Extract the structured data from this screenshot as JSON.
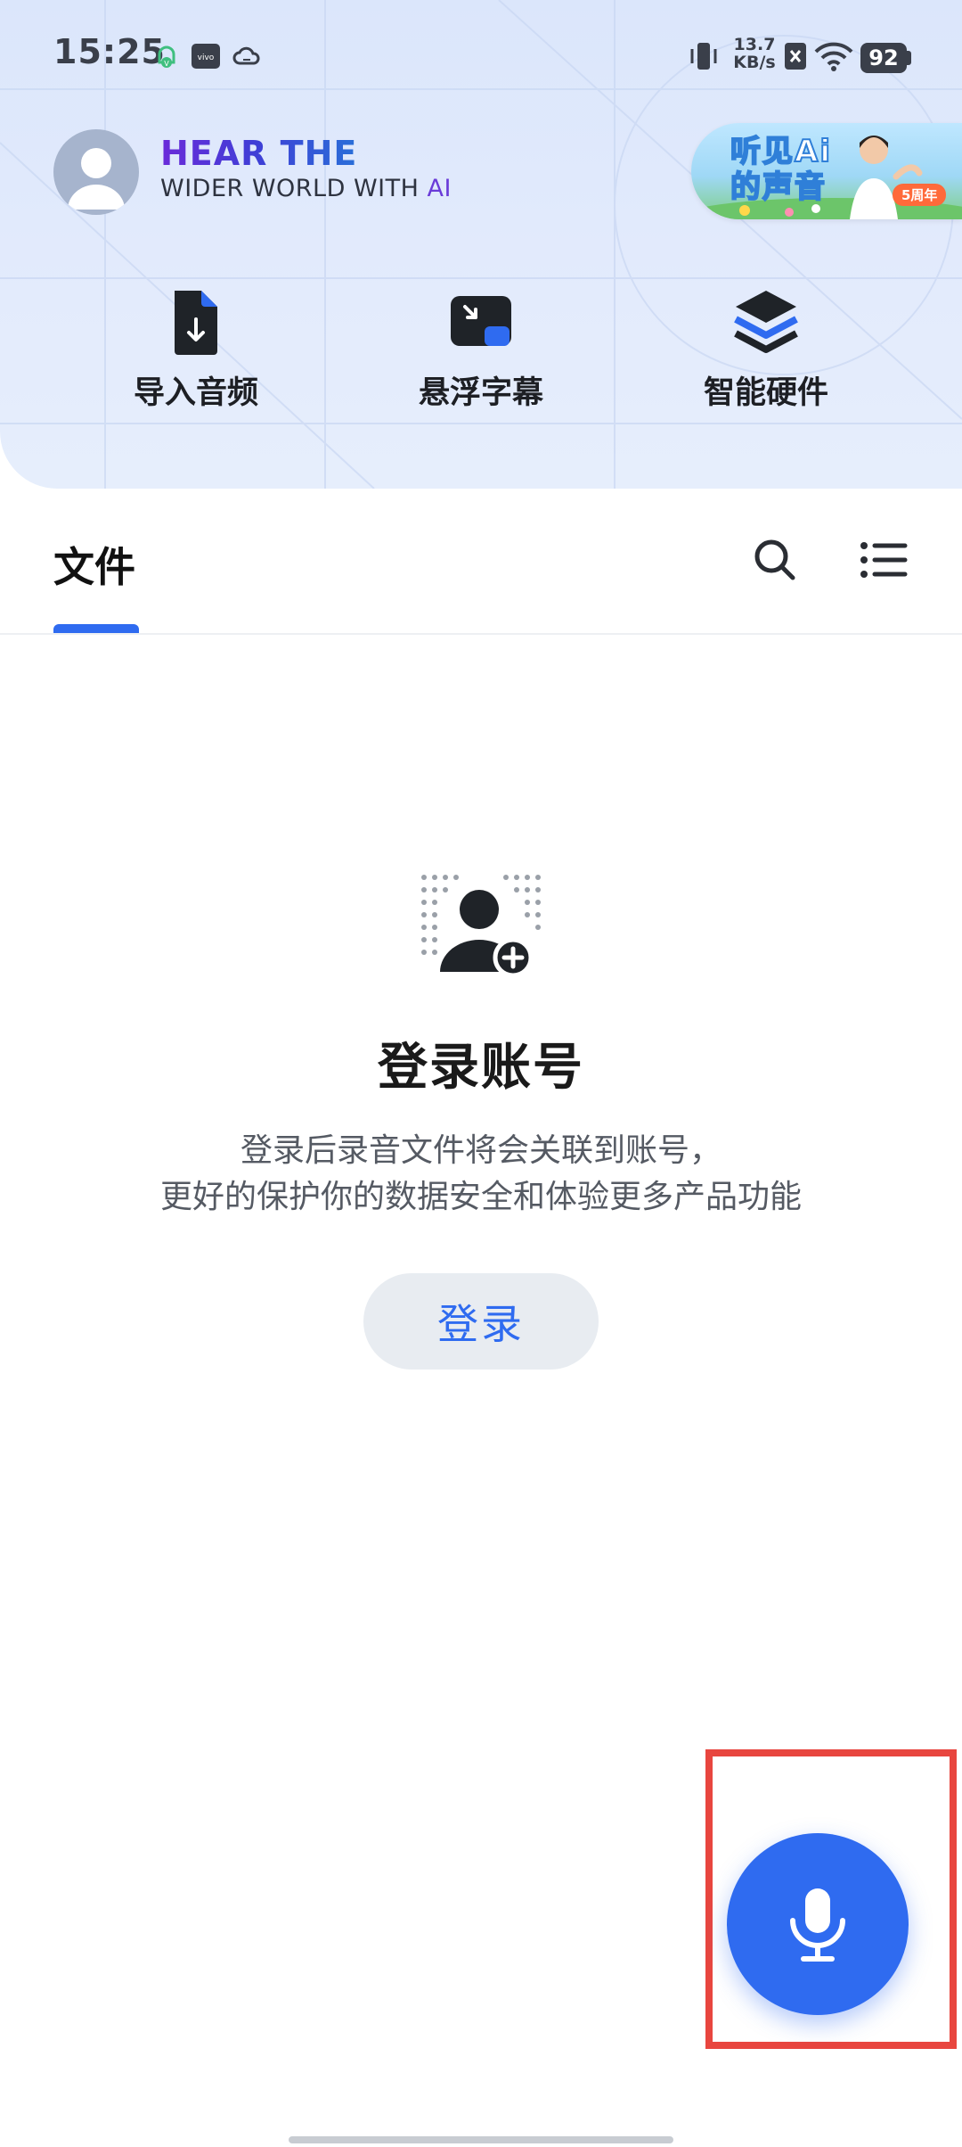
{
  "status_bar": {
    "time": "15:25",
    "net_speed_value": "13.7",
    "net_speed_unit": "KB/s",
    "battery": "92",
    "icons": [
      "notification-bell-icon",
      "vivo-icon",
      "cloud-icon",
      "vibrate-icon",
      "no-sim-icon",
      "wifi-icon",
      "battery-icon"
    ]
  },
  "profile": {
    "slogan_line1": "HEAR THE",
    "slogan_line2_prefix": "WIDER WORLD WITH ",
    "slogan_line2_ai": "AI"
  },
  "promo": {
    "text_line1": "听见Ai",
    "text_line2": "的声音",
    "badge": "5周年"
  },
  "quick_actions": [
    {
      "label": "导入音频",
      "icon": "import-audio-icon"
    },
    {
      "label": "悬浮字幕",
      "icon": "floating-subtitle-icon"
    },
    {
      "label": "智能硬件",
      "icon": "smart-hardware-icon"
    }
  ],
  "tabs": {
    "file": "文件"
  },
  "empty_state": {
    "title": "登录账号",
    "desc_line1": "登录后录音文件将会关联到账号，",
    "desc_line2": "更好的保护你的数据安全和体验更多产品功能",
    "login_button": "登录"
  },
  "colors": {
    "accent": "#2f6bf0",
    "header_bg": "#dbe6fb",
    "highlight": "#e8463f"
  }
}
